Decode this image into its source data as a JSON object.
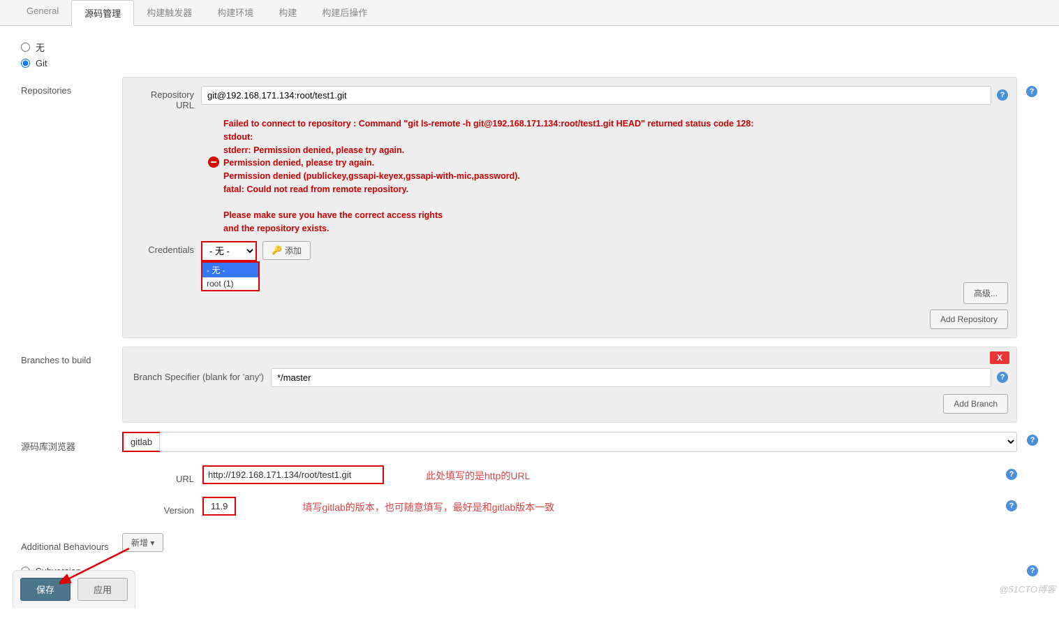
{
  "tabs": {
    "general": "General",
    "scm": "源码管理",
    "triggers": "构建触发器",
    "env": "构建环境",
    "build": "构建",
    "post": "构建后操作"
  },
  "scm_options": {
    "none": "无",
    "git": "Git",
    "svn": "Subversion"
  },
  "repositories_label": "Repositories",
  "repo_url_label": "Repository URL",
  "repo_url_value": "git@192.168.171.134:root/test1.git",
  "error_text": "Failed to connect to repository : Command \"git ls-remote -h git@192.168.171.134:root/test1.git HEAD\" returned status code 128:\nstdout:\nstderr: Permission denied, please try again.\nPermission denied, please try again.\nPermission denied (publickey,gssapi-keyex,gssapi-with-mic,password).\nfatal: Could not read from remote repository.\n\nPlease make sure you have the correct access rights\nand the repository exists.",
  "credentials_label": "Credentials",
  "credentials_value": "- 无 -",
  "credentials_options": {
    "none": "- 无 -",
    "root": "root (1)"
  },
  "add_button": "添加",
  "advanced_button": "高级...",
  "add_repository_button": "Add Repository",
  "branches_label": "Branches to build",
  "branch_specifier_label": "Branch Specifier (blank for 'any')",
  "branch_specifier_value": "*/master",
  "add_branch_button": "Add Branch",
  "close_x": "X",
  "repo_browser_label": "源码库浏览器",
  "repo_browser_value": "gitlab",
  "url_label": "URL",
  "url_value": "http://192.168.171.134/root/test1.git",
  "url_annotation": "此处填写的是http的URL",
  "version_label": "Version",
  "version_value": "11.9",
  "version_annotation": "填写gitlab的版本，也可随意填写，最好是和gitlab版本一致",
  "additional_label": "Additional Behaviours",
  "additional_button": "新增 ▾",
  "save_button": "保存",
  "apply_button": "应用",
  "watermark": "@51CTO博客"
}
